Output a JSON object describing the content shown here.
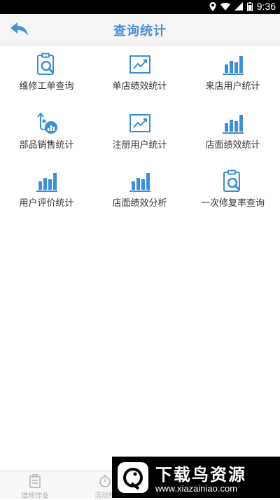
{
  "status_bar": {
    "time": "9:36"
  },
  "header": {
    "title": "查询统计"
  },
  "menu": [
    {
      "label": "维修工单查询",
      "icon": "clipboard-search-icon"
    },
    {
      "label": "单店绩效统计",
      "icon": "trend-chart-icon"
    },
    {
      "label": "来店用户统计",
      "icon": "bar-chart-icon"
    },
    {
      "label": "部品销售统计",
      "icon": "parts-sales-icon"
    },
    {
      "label": "注册用户统计",
      "icon": "trend-chart-icon"
    },
    {
      "label": "店面绩效统计",
      "icon": "bar-chart-icon"
    },
    {
      "label": "用户评价统计",
      "icon": "bar-chart-icon"
    },
    {
      "label": "店面绩效分析",
      "icon": "bar-chart-icon"
    },
    {
      "label": "一次修复率查询",
      "icon": "clipboard-search-icon"
    }
  ],
  "tabbar": {
    "tab1": "维修作业",
    "tab2": "活动预"
  },
  "watermark": {
    "title": "下载鸟资源",
    "url": "www.xiazainiao.com"
  },
  "colors": {
    "accent": "#4a90d9",
    "icon": "#3a8fd8",
    "text": "#333333"
  }
}
